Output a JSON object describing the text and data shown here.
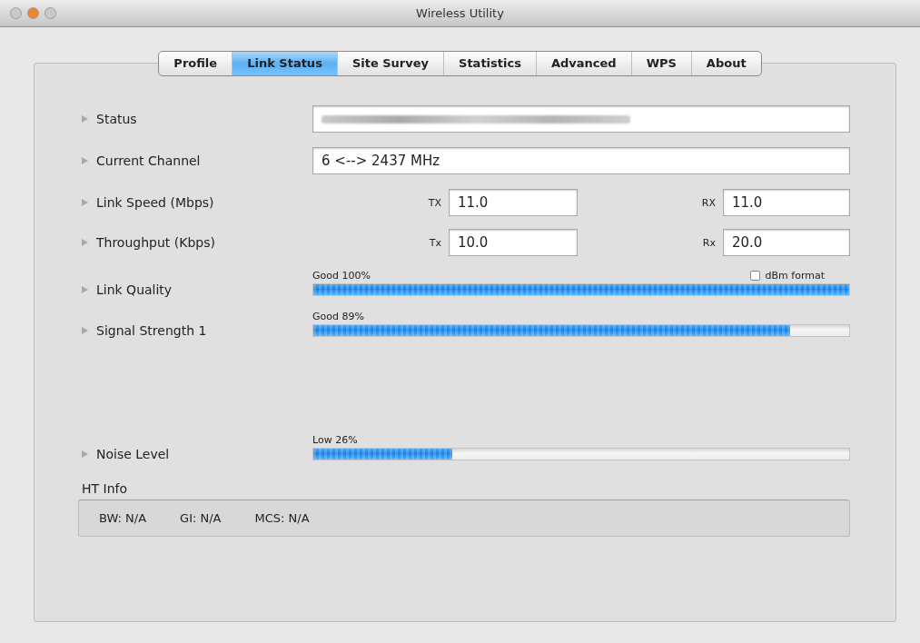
{
  "window": {
    "title": "Wireless Utility",
    "traffic_lights": [
      {
        "color": "#c9c9c9"
      },
      {
        "color": "#f0862a"
      },
      {
        "color": "#c9c9c9"
      }
    ]
  },
  "tabs": [
    {
      "label": "Profile",
      "selected": false
    },
    {
      "label": "Link Status",
      "selected": true
    },
    {
      "label": "Site Survey",
      "selected": false
    },
    {
      "label": "Statistics",
      "selected": false
    },
    {
      "label": "Advanced",
      "selected": false
    },
    {
      "label": "WPS",
      "selected": false
    },
    {
      "label": "About",
      "selected": false
    }
  ],
  "rows": [
    {
      "kind": "field",
      "label": "Status",
      "redacted": true
    },
    {
      "kind": "field",
      "label": "Current Channel",
      "value": "6 <--> 2437 MHz"
    },
    {
      "kind": "pair",
      "label": "Link Speed (Mbps)",
      "tx_label": "TX",
      "tx": "11.0",
      "rx_label": "RX",
      "rx": "11.0"
    },
    {
      "kind": "pair",
      "label": "Throughput (Kbps)",
      "tx_label": "Tx",
      "tx": "10.0",
      "rx_label": "Rx",
      "rx": "20.0"
    },
    {
      "kind": "meter",
      "label": "Link Quality",
      "caption": "Good 100%",
      "level": 1.0,
      "option": {
        "label": "dBm format",
        "checked": false
      }
    },
    {
      "kind": "meter",
      "label": "Signal Strength 1",
      "caption": "Good 89%",
      "level": 0.89
    },
    {
      "kind": "meter",
      "label": "Noise Level",
      "caption": "Low 26%",
      "level": 0.26,
      "spaced": true
    }
  ],
  "ht_info": {
    "title": "HT Info",
    "items": [
      "BW: N/A",
      "GI: N/A",
      "MCS: N/A"
    ]
  }
}
